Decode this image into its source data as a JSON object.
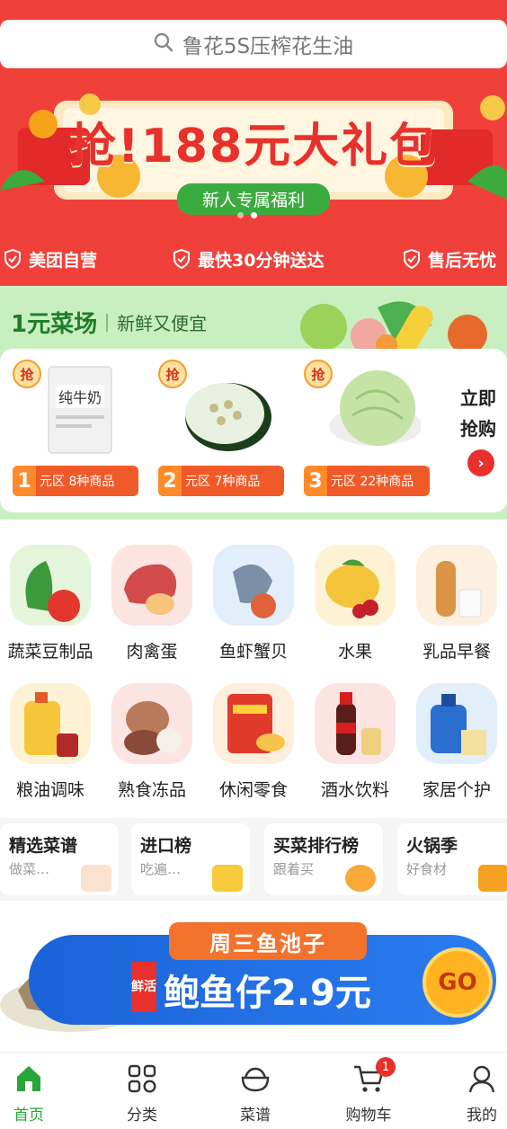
{
  "search": {
    "placeholder": "鲁花5S压榨花生油"
  },
  "promo": {
    "title": "抢!188元大礼包",
    "pill": "新人专属福利"
  },
  "guarantees": [
    "美团自营",
    "最快30分钟送达",
    "售后无忧"
  ],
  "market": {
    "title": "1元菜场",
    "subtitle": "新鲜又便宜",
    "badge": "抢",
    "zones": [
      {
        "num": "1",
        "label": "元区 8种商品"
      },
      {
        "num": "2",
        "label": "元区 7种商品"
      },
      {
        "num": "3",
        "label": "元区 22种商品"
      }
    ],
    "buy_now": "立即抢购"
  },
  "categories": [
    {
      "label": "蔬菜豆制品"
    },
    {
      "label": "肉禽蛋"
    },
    {
      "label": "鱼虾蟹贝"
    },
    {
      "label": "水果"
    },
    {
      "label": "乳品早餐"
    },
    {
      "label": "粮油调味"
    },
    {
      "label": "熟食冻品"
    },
    {
      "label": "休闲零食"
    },
    {
      "label": "酒水饮料"
    },
    {
      "label": "家居个护"
    }
  ],
  "mini_cards": [
    {
      "title": "精选菜谱",
      "sub": "做菜…"
    },
    {
      "title": "进口榜",
      "sub": "吃遍…"
    },
    {
      "title": "买菜排行榜",
      "sub": "跟着买"
    },
    {
      "title": "火锅季",
      "sub": "好食材"
    }
  ],
  "fish_banner": {
    "top": "周三鱼池子",
    "fresh": "鲜活",
    "main": "鲍鱼仔2.9元",
    "go": "GO"
  },
  "tabs": [
    {
      "label": "首页"
    },
    {
      "label": "分类"
    },
    {
      "label": "菜谱"
    },
    {
      "label": "购物车",
      "badge": "1"
    },
    {
      "label": "我的"
    }
  ],
  "colors": {
    "brand_red": "#f0403a",
    "brand_green": "#2aa53a"
  }
}
